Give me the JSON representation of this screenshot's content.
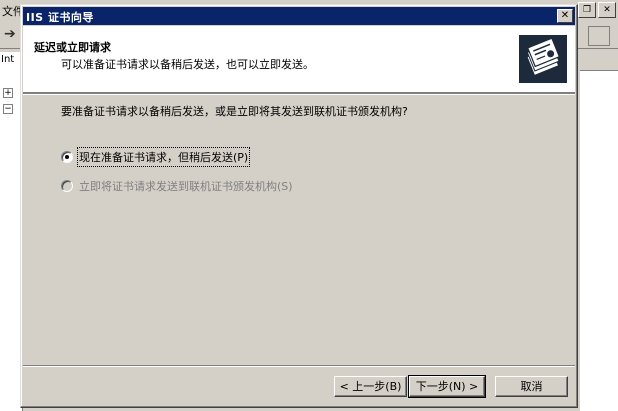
{
  "background_app": {
    "menu_label": "文件",
    "tree_label": "Int",
    "win_btn_restore": "❐",
    "win_btn_close": "✕",
    "toolbar_arrow": "➔"
  },
  "wizard": {
    "title": "IIS 证书向导",
    "close_glyph": "✕",
    "header": {
      "title": "延迟或立即请求",
      "subtitle": "可以准备证书请求以备稍后发送，也可以立即发送。",
      "icon": "certificate-icon"
    },
    "question": "要准备证书请求以备稍后发送，或是立即将其发送到联机证书颁发机构?",
    "options": [
      {
        "label": "现在准备证书请求，但稍后发送(P)",
        "checked": true,
        "enabled": true
      },
      {
        "label": "立即将证书请求发送到联机证书颁发机构(S)",
        "checked": false,
        "enabled": false
      }
    ],
    "buttons": {
      "back": "< 上一步(B)",
      "next": "下一步(N) >",
      "cancel": "取消"
    }
  },
  "colors": {
    "title_bar": "#0a246a",
    "face": "#d4d0c8",
    "disabled_text": "#808080"
  }
}
